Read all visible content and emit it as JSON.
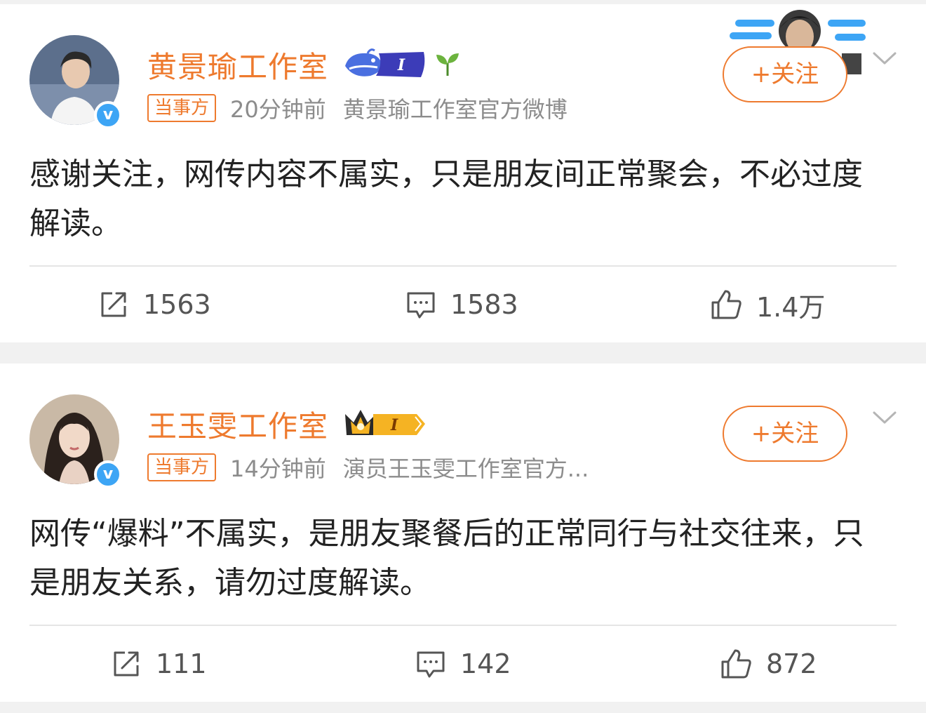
{
  "posts": [
    {
      "name": "黄景瑜工作室",
      "badge_level": "I",
      "party_tag": "当事方",
      "time": "20分钟前",
      "source": "黄景瑜工作室官方微博",
      "follow_label": "+关注",
      "text": "感谢关注，网传内容不属实，只是朋友间正常聚会，不必过度解读。",
      "reposts": "1563",
      "comments": "1583",
      "likes": "1.4万"
    },
    {
      "name": "王玉雯工作室",
      "badge_level": "I",
      "party_tag": "当事方",
      "time": "14分钟前",
      "source": "演员王玉雯工作室官方...",
      "follow_label": "+关注",
      "text": "网传“爆料”不属实，是朋友聚餐后的正常同行与社交往来，只是朋友关系，请勿过度解读。",
      "reposts": "111",
      "comments": "142",
      "likes": "872"
    }
  ],
  "colors": {
    "accent": "#ee7a2e",
    "verify": "#3da5f5",
    "meta_text": "#8c8c8c",
    "body_text": "#222222",
    "page_bg": "#f1f1f1"
  },
  "icons": {
    "repost": "repost-icon",
    "comment": "comment-icon",
    "like": "like-icon",
    "verify": "verified-icon",
    "chevron": "chevron-down-icon"
  }
}
